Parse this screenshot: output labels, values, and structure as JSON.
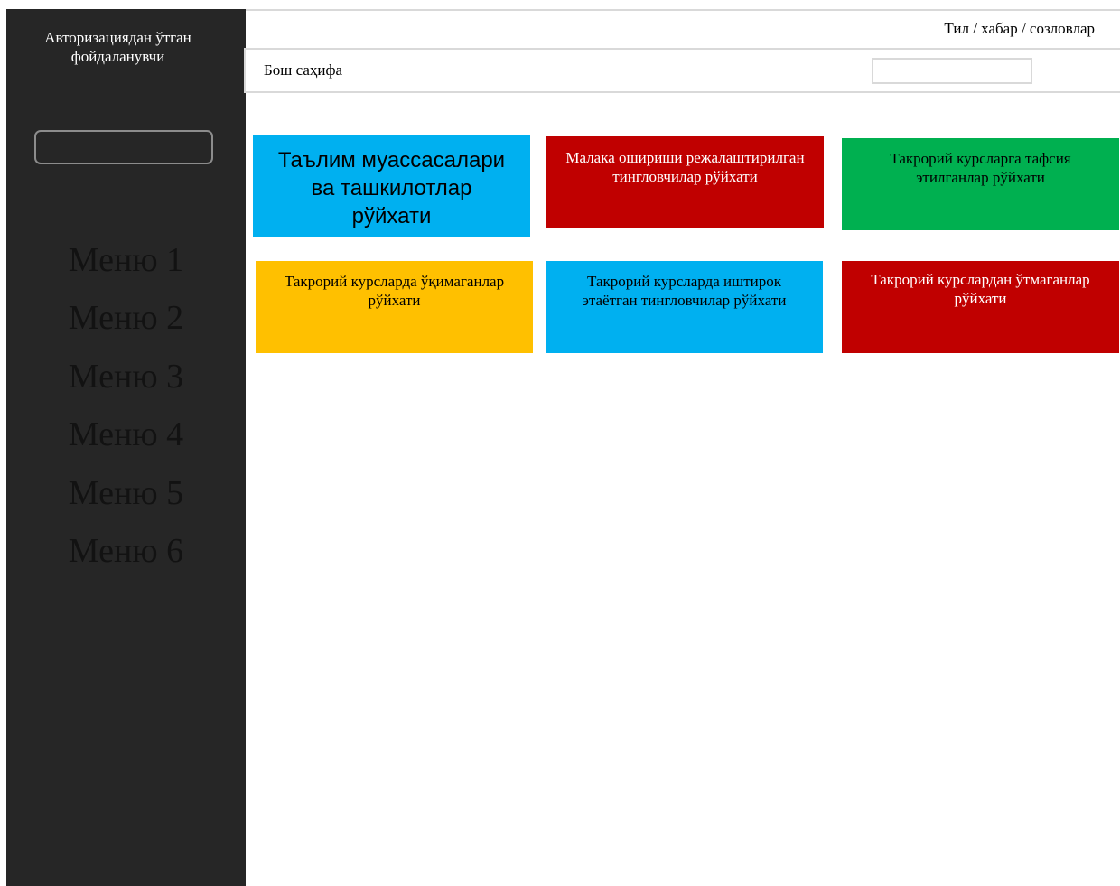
{
  "sidebar": {
    "user_label": "Авторизациядан ўтган фойдаланувчи",
    "menu": [
      "Меню 1",
      "Меню 2",
      "Меню 3",
      "Меню 4",
      "Меню 5",
      "Меню 6"
    ]
  },
  "header": {
    "links": "Тил / хабар / созловлар"
  },
  "breadcrumb": {
    "title": "Бош саҳифа"
  },
  "tiles": [
    {
      "label": "Таълим муассасалари ва ташкилотлар рўйхати",
      "color": "#00b0f0",
      "text_color": "#000000"
    },
    {
      "label": "Малака ошириши режалаштирилган тингловчилар рўйхати",
      "color": "#c00000",
      "text_color": "#ffffff"
    },
    {
      "label": "Такрорий курсларга тафсия этилганлар рўйхати",
      "color": "#00b050",
      "text_color": "#000000"
    },
    {
      "label": "Такрорий курсларда ўқимаганлар рўйхати",
      "color": "#ffc000",
      "text_color": "#000000"
    },
    {
      "label": "Такрорий курсларда иштирок этаётган тингловчилар рўйхати",
      "color": "#00b0f0",
      "text_color": "#000000"
    },
    {
      "label": "Такрорий курслардан ўтмаганлар рўйхати",
      "color": "#c00000",
      "text_color": "#ffffff"
    }
  ]
}
